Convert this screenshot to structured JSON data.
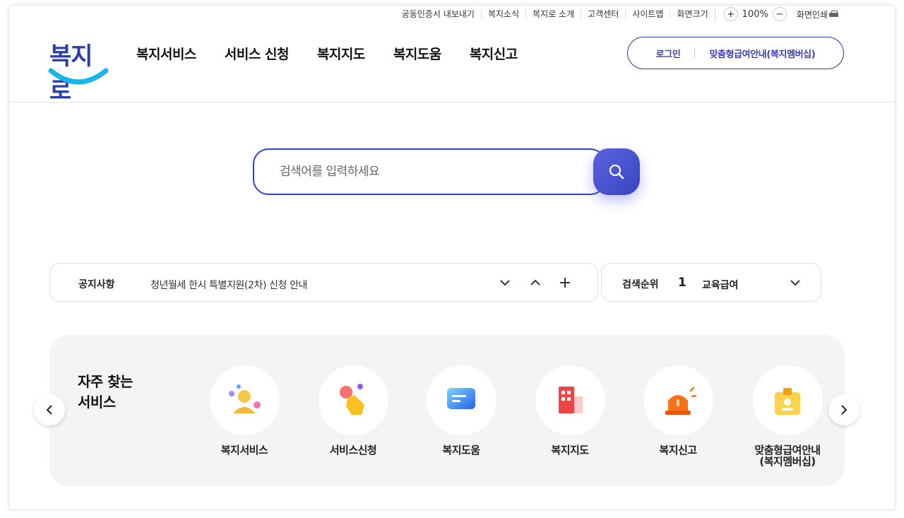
{
  "utility": {
    "items": [
      "공동인증서 내보내기",
      "복지소식",
      "복지로 소개",
      "고객센터",
      "사이트맵",
      "화면크기"
    ],
    "zoom_in": "+",
    "zoom_value": "100%",
    "zoom_out": "−",
    "print_label": "화면인쇄"
  },
  "header": {
    "logo_text": "복지로",
    "nav": [
      "복지서비스",
      "서비스 신청",
      "복지지도",
      "복지도움",
      "복지신고"
    ],
    "login_label": "로그인",
    "membership_label": "맞춤형급여안내(복지멤버십)"
  },
  "search": {
    "placeholder": "검색어를 입력하세요",
    "value": ""
  },
  "notice": {
    "label": "공지사항",
    "text": "청년월세 한시 특별지원(2차) 신청 안내"
  },
  "ranking": {
    "label": "검색순위",
    "rank": "1",
    "term": "교육급여"
  },
  "frequent": {
    "title_line1": "자주 찾는",
    "title_line2": "서비스",
    "services": [
      {
        "label": "복지서비스",
        "icon": "people-icon"
      },
      {
        "label": "서비스신청",
        "icon": "hand-tap-icon"
      },
      {
        "label": "복지도움",
        "icon": "chat-icon"
      },
      {
        "label": "복지지도",
        "icon": "building-icon"
      },
      {
        "label": "복지신고",
        "icon": "siren-icon"
      },
      {
        "label_line1": "맞춤형급여안내",
        "label_line2": "(복지멤버십)",
        "icon": "id-badge-icon"
      }
    ]
  }
}
